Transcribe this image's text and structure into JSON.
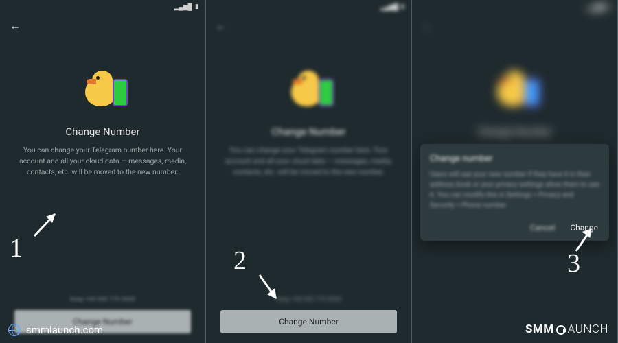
{
  "statusbar": {
    "time": "",
    "signal": "▂▄▆█",
    "wifi": "⋮",
    "battery": "▮"
  },
  "screen": {
    "title": "Change Number",
    "description": "You can change your Telegram number here. Your account and all your cloud data — messages, media, contacts, etc. will be moved to the new number.",
    "current_hint": "Keep +00 000 770 0000",
    "cta": "Change Number"
  },
  "dialog": {
    "title": "Change number",
    "body": "Users will see your new number if they have it in their address book or your privacy settings allow them to see it. You can modify this in Settings > Privacy and Security > Phone number.",
    "cancel": "Cancel",
    "confirm": "Change"
  },
  "steps": {
    "one": "1",
    "two": "2",
    "three": "3"
  },
  "footer": {
    "site": "smmlaunch.com",
    "brand_a": "SMM",
    "brand_b": "AUNCH"
  }
}
